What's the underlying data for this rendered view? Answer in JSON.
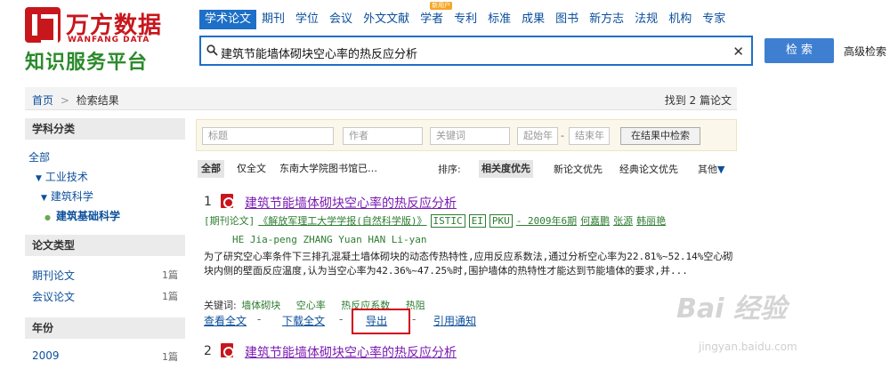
{
  "logo": {
    "cn": "万方数据",
    "en": "WANFANG DATA",
    "sub": "知识服务平台"
  },
  "nav": {
    "items": [
      "学术论文",
      "期刊",
      "学位",
      "会议",
      "外文文献",
      "学者",
      "专利",
      "标准",
      "成果",
      "图书",
      "新方志",
      "法规",
      "机构",
      "专家"
    ],
    "badge": "新用户"
  },
  "search": {
    "query": "建筑节能墙体砌块空心率的热反应分析",
    "button": "检 索",
    "advanced": "高级检索"
  },
  "breadcrumb": {
    "home": "首页",
    "sep": ">",
    "current": "检索结果"
  },
  "found": {
    "text": "找到 2 篇论文"
  },
  "sidebar": {
    "subject_title": "学科分类",
    "all": "全部",
    "tree": [
      "工业技术",
      "建筑科学",
      "建筑基础科学"
    ],
    "type_title": "论文类型",
    "types": [
      {
        "label": "期刊论文",
        "count": "1篇"
      },
      {
        "label": "会议论文",
        "count": "1篇"
      }
    ],
    "year_title": "年份",
    "years": [
      {
        "label": "2009",
        "count": "1篇"
      }
    ]
  },
  "filters": {
    "title_ph": "标题",
    "author_ph": "作者",
    "keyword_ph": "关键词",
    "start_year_ph": "起始年",
    "dash": "-",
    "end_year_ph": "结束年",
    "search_in_results": "在结果中检索"
  },
  "tabs": {
    "all": "全部",
    "fulltext_only": "仅全文",
    "library": "东南大学院图书馆已…"
  },
  "sort": {
    "label": "排序:",
    "relevance": "相关度优先",
    "newest": "新论文优先",
    "classic": "经典论文优先",
    "more": "其他"
  },
  "results": [
    {
      "num": "1",
      "title": "建筑节能墙体砌块空心率的热反应分析",
      "type": "[期刊论文]",
      "journal": "《解放军理工大学学报(自然科学版)》",
      "tags": [
        "ISTIC",
        "EI",
        "PKU"
      ],
      "issue": "- 2009年6期",
      "authors": [
        "何嘉鹏",
        "张源",
        "韩丽艳"
      ],
      "authors_en": "HE Jia-peng   ZHANG Yuan   HAN Li-yan",
      "abstract": "为了研究空心率条件下三排孔混凝土墙体砌块的动态传热特性,应用反应系数法,通过分析空心率为22.81%~52.14%空心砌块内侧的壁面反应温度,认为当空心率为42.36%~47.25%时,围护墙体的热特性才能达到节能墙体的要求,并...",
      "keywords_label": "关键词:",
      "keywords": [
        "墙体砌块",
        "空心率",
        "热反应系数",
        "热阻"
      ],
      "actions": [
        "查看全文",
        "下载全文",
        "导出",
        "引用通知"
      ]
    },
    {
      "num": "2",
      "title": "建筑节能墙体砌块空心率的热反应分析"
    }
  ],
  "watermark": {
    "brand": "Bai 经验",
    "url": "jingyan.baidu.com"
  }
}
